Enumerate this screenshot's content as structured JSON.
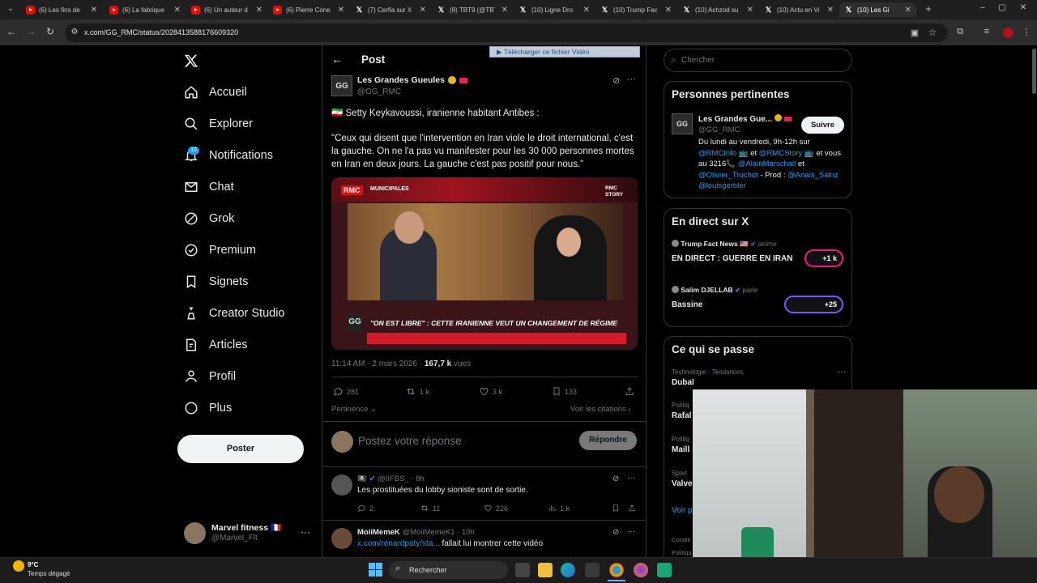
{
  "browser": {
    "tabs": [
      {
        "label": "(6) Les fins de",
        "icon": "youtube-icon"
      },
      {
        "label": "(6) La fabrique",
        "icon": "youtube-icon"
      },
      {
        "label": "(6) Un auteur d",
        "icon": "youtube-icon"
      },
      {
        "label": "(6) Pierre Cone",
        "icon": "youtube-icon"
      },
      {
        "label": "(7) Cerfia sur X",
        "icon": "x-icon"
      },
      {
        "label": "(8) TBT9 (@TBT",
        "icon": "x-icon"
      },
      {
        "label": "(10) Ligne Dro",
        "icon": "x-icon"
      },
      {
        "label": "(10) Trump Fac",
        "icon": "x-icon"
      },
      {
        "label": "(10) Achzod su",
        "icon": "x-icon"
      },
      {
        "label": "(10) Actu en Vi",
        "icon": "x-icon"
      },
      {
        "label": "(10) Les Gi",
        "icon": "x-icon"
      }
    ],
    "url": "x.com/GG_RMC/status/2028413588176609320"
  },
  "nav": {
    "items": [
      "Accueil",
      "Explorer",
      "Notifications",
      "Chat",
      "Grok",
      "Premium",
      "Signets",
      "Creator Studio",
      "Articles",
      "Profil",
      "Plus"
    ],
    "notif_badge": "10",
    "post_button": "Poster",
    "account_name": "Marvel fitness 🇫🇷",
    "account_handle": "@Marvel_Flt"
  },
  "post": {
    "header": "Post",
    "author_name": "Les Grandes Gueules",
    "author_handle": "@GG_RMC",
    "line1": "🇮🇷 Setty Keykavoussi, iranienne habitant Antibes :",
    "quote": "\"Ceux qui disent que l'intervention en Iran viole le droit international, c'est la gauche. On ne l'a pas vu manifester pour les 30 000 personnes mortes en Iran en deux jours. La gauche c'est pas positif pour nous.\"",
    "download_overlay": "Télécharger ce fichier Vidéo",
    "video_banner": "\"ON EST LIBRE\" : CETTE IRANIENNE VEUT UN CHANGEMENT DE RÉGIME",
    "video_tag": "MUNICIPALES",
    "video_channel": "RMC STORY",
    "time": "11:14 AM · 2 mars 2026 · ",
    "views_count": "167,7 k",
    "views_label": " vues",
    "replies": "281",
    "reposts": "1 k",
    "likes": "3 k",
    "bookmarks": "133",
    "relevance": "Pertinence",
    "see_quotes": "Voir les citations",
    "reply_placeholder": "Postez votre réponse",
    "reply_button": "Répondre"
  },
  "replies": [
    {
      "handle": "@IIFBS_ · 8h",
      "text": "Les prostituées du lobby sioniste sont de sortie.",
      "replies": "2",
      "reposts": "11",
      "likes": "226",
      "views": "1 k"
    },
    {
      "name": "MoiiMemeK",
      "handle": "@MoiiMemeK1 · 10h",
      "link": "x.com/renardpaty/sta...",
      "text": " fallait lui montrer cette vidéo"
    }
  ],
  "sidebar": {
    "search_placeholder": "Chercher",
    "relevant_title": "Personnes pertinentes",
    "relevant_name": "Les Grandes Gue...",
    "relevant_handle": "@GG_RMC",
    "follow_button": "Suivre",
    "bio": [
      {
        "t": "Du lundi au vendredi, 9h-12h sur ",
        "c": "text"
      },
      {
        "t": "@RMCInfo",
        "c": "link"
      },
      {
        "t": " 📺 et ",
        "c": "text"
      },
      {
        "t": "@RMCStory",
        "c": "link"
      },
      {
        "t": " 📺 et vous au 3216📞 ",
        "c": "text"
      },
      {
        "t": "@AlainMarschall",
        "c": "link"
      },
      {
        "t": " et ",
        "c": "text"
      },
      {
        "t": "@Olivier_Truchot",
        "c": "link"
      },
      {
        "t": " - Prod : ",
        "c": "text"
      },
      {
        "t": "@Anais_Salnz",
        "c": "link"
      },
      {
        "t": " ",
        "c": "text"
      },
      {
        "t": "@louisgerbler",
        "c": "link"
      }
    ],
    "live_title": "En direct sur X",
    "live": [
      {
        "host": "Trump Fact News 🇺🇸",
        "role": " anime",
        "title": "EN DIRECT : GUERRE EN IRAN",
        "count": "+1 k"
      },
      {
        "host": "Salim DJELLAB",
        "role": " parle",
        "title": "Bassine",
        "count": "+25"
      }
    ],
    "happening_title": "Ce qui se passe",
    "trends": [
      {
        "meta": "Technologie · Tendances",
        "name": "Dubaï"
      },
      {
        "meta": "Politiq",
        "name": "Rafal"
      },
      {
        "meta": "Politiq",
        "name": "Maill"
      },
      {
        "meta": "Sport",
        "name": "Valve"
      }
    ],
    "see_more": "Voir p",
    "footer1": "Conditi",
    "footer2": "Politiqu"
  },
  "taskbar": {
    "weather_temp": "9°C",
    "weather_desc": "Temps dégagé",
    "search": "Rechercher"
  },
  "colors": {
    "accent": "#1d9bf0",
    "border": "#2f3336",
    "muted": "#71767b"
  }
}
